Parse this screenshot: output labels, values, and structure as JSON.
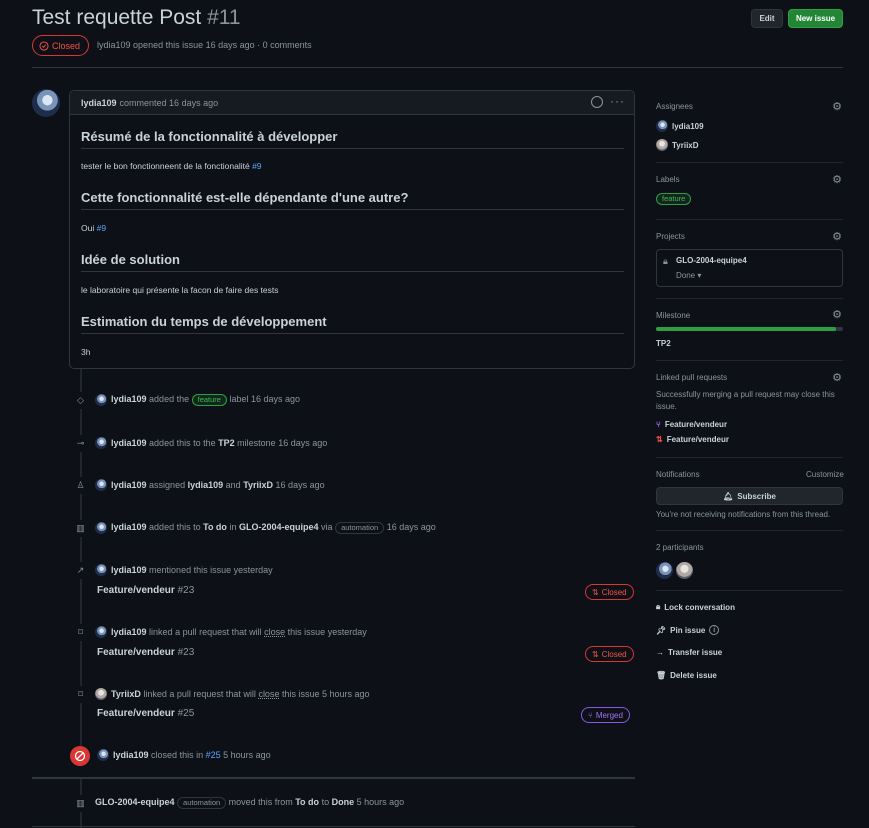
{
  "header": {
    "title": "Test requette Post",
    "number": "#11",
    "edit_label": "Edit",
    "new_issue_label": "New issue",
    "state_label": "Closed",
    "author": "lydia109",
    "meta_text": "opened this issue 16 days ago · 0 comments"
  },
  "comment": {
    "author": "lydia109",
    "action": "commented 16 days ago",
    "sections": [
      {
        "heading": "Résumé de la fonctionnalité à développer",
        "text": "tester le bon fonctionneent de la fonctionalité",
        "ref": "#9"
      },
      {
        "heading": "Cette fonctionnalité est-elle dépendante d'une autre?",
        "text": "Oui",
        "ref": "#9"
      },
      {
        "heading": "Idée de solution",
        "text": "le laboratoire qui présente la facon de faire des tests",
        "ref": ""
      },
      {
        "heading": "Estimation du temps de développement",
        "text": "3h",
        "ref": ""
      }
    ]
  },
  "timeline": {
    "e1": {
      "user": "lydia109",
      "pre": "added the",
      "label": "feature",
      "post": "label",
      "time": "16 days ago"
    },
    "e2": {
      "user": "lydia109",
      "pre": "added this to the",
      "milestone": "TP2",
      "post": "milestone",
      "time": "16 days ago"
    },
    "e3": {
      "user": "lydia109",
      "pre": "assigned",
      "a1": "lydia109",
      "and": "and",
      "a2": "TyriixD",
      "time": "16 days ago"
    },
    "e4": {
      "user": "lydia109",
      "pre": "added this to",
      "column": "To do",
      "in": "in",
      "project": "GLO-2004-equipe4",
      "via": "via",
      "bot": "automation",
      "time": "16 days ago"
    },
    "e5": {
      "user": "lydia109",
      "text": "mentioned this issue",
      "time": "yesterday",
      "pr_title": "Feature/vendeur",
      "pr_num": "#23",
      "state": "Closed"
    },
    "e6": {
      "user": "lydia109",
      "text": "linked a pull request that will",
      "close": "close",
      "text2": "this issue",
      "time": "yesterday",
      "pr_title": "Feature/vendeur",
      "pr_num": "#23",
      "state": "Closed"
    },
    "e7": {
      "user": "TyriixD",
      "text": "linked a pull request that will",
      "close": "close",
      "text2": "this issue",
      "time": "5 hours ago",
      "pr_title": "Feature/vendeur",
      "pr_num": "#25",
      "state": "Merged"
    },
    "e8": {
      "user": "lydia109",
      "text": "closed this in",
      "ref": "#25",
      "time": "5 hours ago"
    },
    "e9": {
      "project": "GLO-2004-equipe4",
      "bot": "automation",
      "text": "moved this from",
      "from": "To do",
      "to_word": "to",
      "to": "Done",
      "time": "5 hours ago"
    }
  },
  "sidebar": {
    "assignees_title": "Assignees",
    "assignees": [
      "lydia109",
      "TyriixD"
    ],
    "labels_title": "Labels",
    "label": "feature",
    "projects_title": "Projects",
    "project_name": "GLO-2004-equipe4",
    "project_status": "Done",
    "milestone_title": "Milestone",
    "milestone_progress": 0.96,
    "milestone_name": "TP2",
    "linked_title": "Linked pull requests",
    "linked_desc": "Successfully merging a pull request may close this issue.",
    "linked_prs": [
      "Feature/vendeur",
      "Feature/vendeur"
    ],
    "notifications_title": "Notifications",
    "customize_label": "Customize",
    "subscribe_label": "Subscribe",
    "notif_desc": "You're not receiving notifications from this thread.",
    "participants_title": "2 participants",
    "lock_label": "Lock conversation",
    "pin_label": "Pin issue",
    "transfer_label": "Transfer issue",
    "delete_label": "Delete issue"
  },
  "colors": {
    "closed": "#f85149",
    "merged": "#a371f7",
    "green": "#238636",
    "link": "#58a6ff"
  }
}
